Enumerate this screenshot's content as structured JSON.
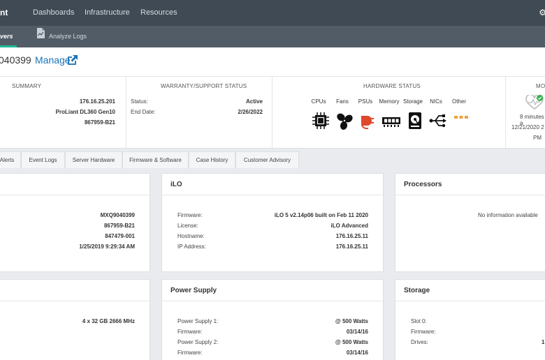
{
  "topnav": {
    "brand": "nt",
    "items": [
      "Dashboards",
      "Infrastructure",
      "Resources"
    ],
    "right_icon": "⚙"
  },
  "subnav": {
    "active_label": "vers",
    "logs_label": "Analyze Logs"
  },
  "title": {
    "serial": "040399",
    "manage": "Manage"
  },
  "summary": {
    "heading": "SUMMARY",
    "values": [
      "176.16.25.201",
      "ProLiant DL360 Gen10",
      "867959-B21"
    ]
  },
  "warranty": {
    "heading": "WARRANTY/SUPPORT STATUS",
    "status_label": "Status:",
    "status_value": "Active",
    "end_label": "End Date:",
    "end_value": "2/26/2022"
  },
  "hardware": {
    "heading": "HARDWARE STATUS",
    "items": [
      {
        "label": "CPUs",
        "icon": "cpu-icon"
      },
      {
        "label": "Fans",
        "icon": "fan-icon"
      },
      {
        "label": "PSUs",
        "icon": "psu-icon"
      },
      {
        "label": "Memory",
        "icon": "memory-icon"
      },
      {
        "label": "Storage",
        "icon": "storage-icon"
      },
      {
        "label": "NICs",
        "icon": "nic-icon"
      },
      {
        "label": "Other",
        "icon": "other-icon"
      }
    ],
    "colors": {
      "ok": "#111111",
      "warn": "#e0482b",
      "other": "#f0a13c"
    }
  },
  "monitor": {
    "heading": "MO",
    "line1": "8 minutes a",
    "line2": "12/21/2020 2",
    "line3": "PM"
  },
  "tabs": [
    "Alerts",
    "Event Logs",
    "Server Hardware",
    "Firmware & Software",
    "Case History",
    "Customer Advisory"
  ],
  "card_general": {
    "values": [
      "MXQ9040399",
      "867959-B21",
      "847479-001",
      "1/25/2019 9:29:34 AM"
    ]
  },
  "card_ilo": {
    "title": "iLO",
    "rows": [
      {
        "label": "Firmware:",
        "value": "iLO 5 v2.14p06 built on Feb 11 2020"
      },
      {
        "label": "License:",
        "value": "iLO Advanced"
      },
      {
        "label": "Hostname:",
        "value": "176.16.25.11"
      },
      {
        "label": "IP Address:",
        "value": "176.16.25.11"
      }
    ]
  },
  "card_processors": {
    "title": "Processors",
    "empty": "No information available"
  },
  "card_memory": {
    "value": "4 x 32 GB 2666 MHz"
  },
  "card_power": {
    "title": "Power Supply",
    "rows": [
      {
        "label": "Power Supply 1:",
        "value": "@ 500 Watts"
      },
      {
        "label": "Firmware:",
        "value": "03/14/16"
      },
      {
        "label": "Power Supply 2:",
        "value": "@ 500 Watts"
      },
      {
        "label": "Firmware:",
        "value": "03/14/16"
      }
    ]
  },
  "card_storage": {
    "title": "Storage",
    "rows": [
      {
        "label": "Slot 0:",
        "value": ""
      },
      {
        "label": "Firmware:",
        "value": ""
      },
      {
        "label": "Drives:",
        "value": "1"
      }
    ]
  }
}
